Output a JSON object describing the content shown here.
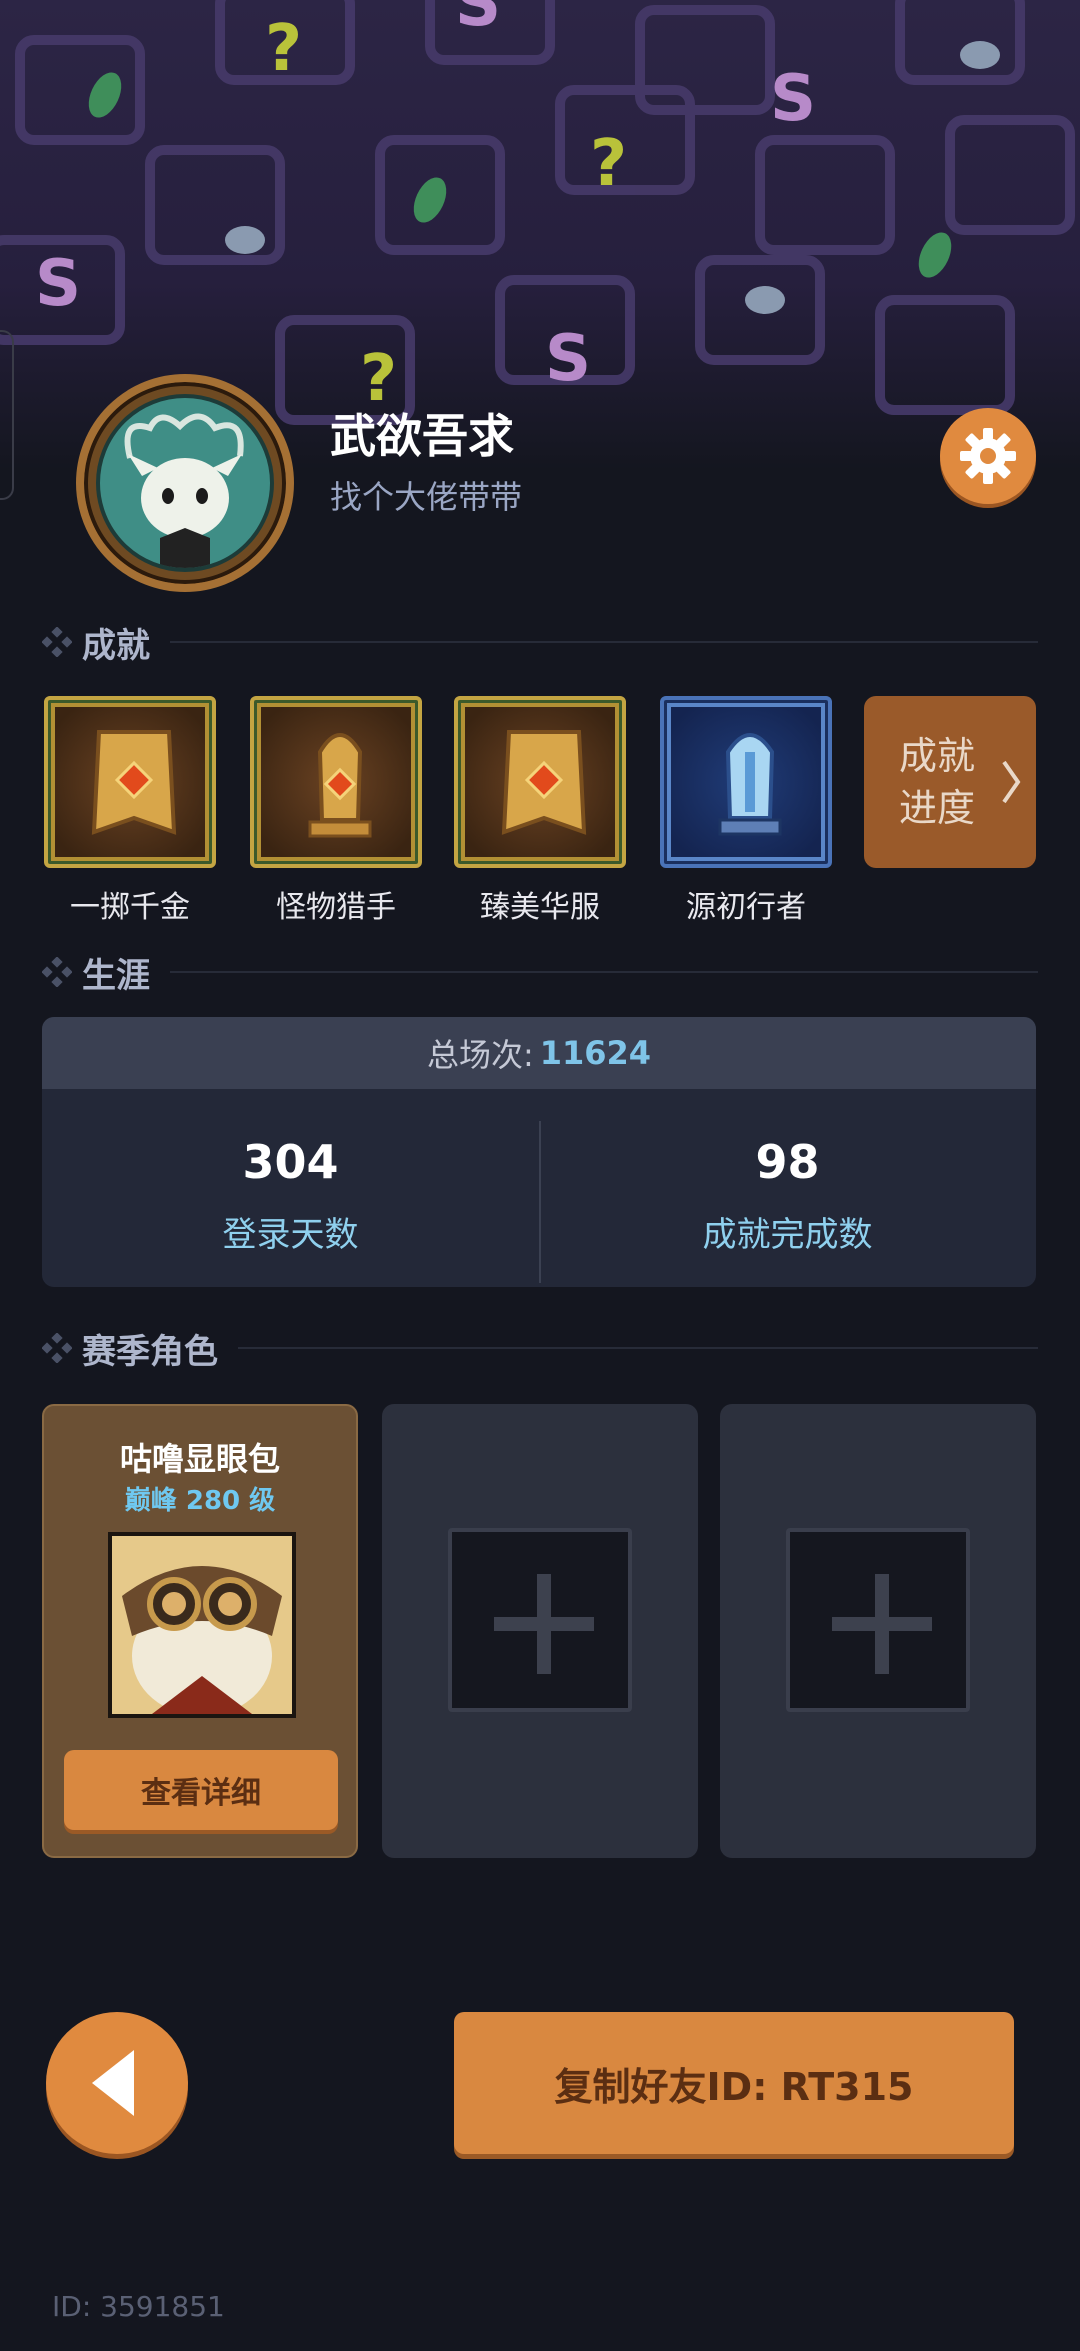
{
  "profile": {
    "username": "武欲吾求",
    "signature": "找个大佬带带"
  },
  "sections": {
    "achievements": "成就",
    "career": "生涯",
    "season_roles": "赛季角色"
  },
  "achievements": [
    {
      "label": "一掷千金",
      "style": "gold",
      "icon": "gold-card-badge-icon"
    },
    {
      "label": "怪物猎手",
      "style": "gold",
      "icon": "gold-sword-badge-icon"
    },
    {
      "label": "臻美华服",
      "style": "gold",
      "icon": "gold-card-badge-icon"
    },
    {
      "label": "源初行者",
      "style": "blue",
      "icon": "blue-crystal-badge-icon"
    }
  ],
  "achievement_progress": {
    "line1": "成就",
    "line2": "进度"
  },
  "career": {
    "total_label": "总场次:",
    "total_value": "11624",
    "stats": [
      {
        "value": "304",
        "label": "登录天数"
      },
      {
        "value": "98",
        "label": "成就完成数"
      }
    ]
  },
  "season_roles": [
    {
      "name": "咕噜显眼包",
      "level": "巅峰 280 级",
      "button": "查看详细",
      "filled": true
    },
    {
      "filled": false
    },
    {
      "filled": false
    }
  ],
  "actions": {
    "copy_friend_id": "复制好友ID: RT315"
  },
  "footer": {
    "id_text": "ID: 3591851"
  },
  "colors": {
    "accent_orange": "#e08a3f",
    "background": "#14161f",
    "stat_blue": "#8fd0ee"
  }
}
